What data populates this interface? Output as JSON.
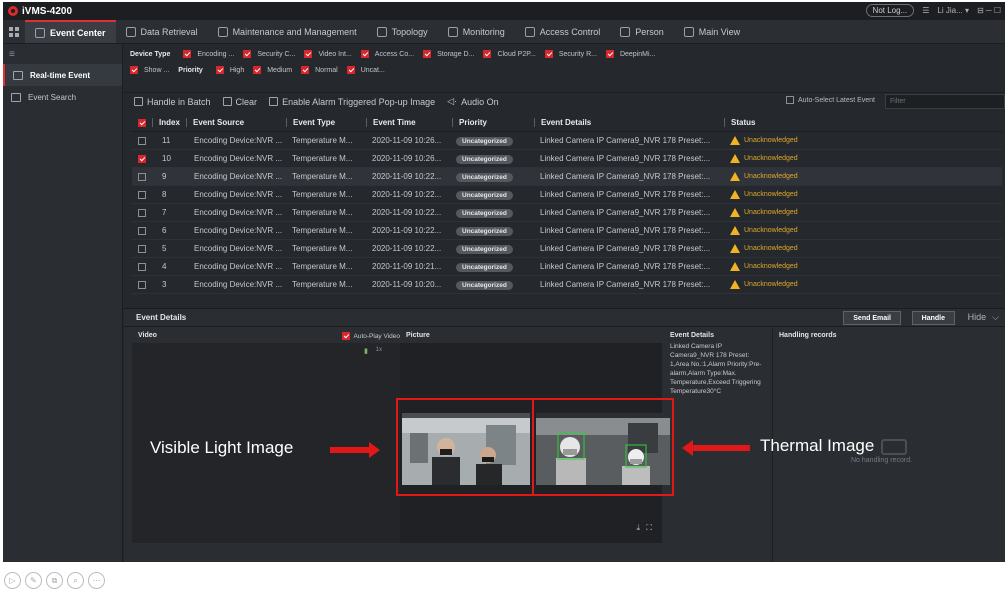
{
  "app": {
    "title": "iVMS-4200"
  },
  "titlebar": {
    "not_logged": "Not Log...",
    "user": "Li Jia... ▾",
    "controls": "⊟ ─ ☐"
  },
  "tabs": [
    {
      "label": "Event Center",
      "active": true
    },
    {
      "label": "Data Retrieval"
    },
    {
      "label": "Maintenance and Management"
    },
    {
      "label": "Topology"
    },
    {
      "label": "Monitoring"
    },
    {
      "label": "Access Control"
    },
    {
      "label": "Person"
    },
    {
      "label": "Main View"
    }
  ],
  "sidebar": {
    "menu_icon": "≡",
    "items": [
      {
        "label": "Real-time Event",
        "active": true
      },
      {
        "label": "Event Search"
      }
    ]
  },
  "filters": {
    "device_type_label": "Device Type",
    "device_types": [
      "Encoding ...",
      "Security C...",
      "Video Int...",
      "Access Co...",
      "Storage D...",
      "Cloud P2P...",
      "Security R...",
      "DeepinMi..."
    ],
    "show_label": "Show ...",
    "priority_label": "Priority",
    "priorities": [
      "High",
      "Medium",
      "Normal",
      "Uncat..."
    ]
  },
  "toolbar": {
    "handle_batch": "Handle in Batch",
    "clear": "Clear",
    "enable_popup": "Enable Alarm Triggered Pop-up Image",
    "audio_on": "Audio On",
    "auto_select": "Auto-Select Latest Event",
    "filter_placeholder": "Filter"
  },
  "table": {
    "headers": [
      "Index",
      "Event Source",
      "Event Type",
      "Event Time",
      "Priority",
      "Event Details",
      "Status"
    ],
    "rows": [
      {
        "index": "11",
        "source": "Encoding Device:NVR ...",
        "type": "Temperature M...",
        "time": "2020-11-09 10:26...",
        "priority": "Uncategorized",
        "details": "Linked Camera IP Camera9_NVR 178 Preset:...",
        "status": "Unacknowledged",
        "checked": false
      },
      {
        "index": "10",
        "source": "Encoding Device:NVR ...",
        "type": "Temperature M...",
        "time": "2020-11-09 10:26...",
        "priority": "Uncategorized",
        "details": "Linked Camera IP Camera9_NVR 178 Preset:...",
        "status": "Unacknowledged",
        "checked": true
      },
      {
        "index": "9",
        "source": "Encoding Device:NVR ...",
        "type": "Temperature M...",
        "time": "2020-11-09 10:22...",
        "priority": "Uncategorized",
        "details": "Linked Camera IP Camera9_NVR 178 Preset:...",
        "status": "Unacknowledged",
        "checked": false,
        "selected": true
      },
      {
        "index": "8",
        "source": "Encoding Device:NVR ...",
        "type": "Temperature M...",
        "time": "2020-11-09 10:22...",
        "priority": "Uncategorized",
        "details": "Linked Camera IP Camera9_NVR 178 Preset:...",
        "status": "Unacknowledged",
        "checked": false
      },
      {
        "index": "7",
        "source": "Encoding Device:NVR ...",
        "type": "Temperature M...",
        "time": "2020-11-09 10:22...",
        "priority": "Uncategorized",
        "details": "Linked Camera IP Camera9_NVR 178 Preset:...",
        "status": "Unacknowledged",
        "checked": false
      },
      {
        "index": "6",
        "source": "Encoding Device:NVR ...",
        "type": "Temperature M...",
        "time": "2020-11-09 10:22...",
        "priority": "Uncategorized",
        "details": "Linked Camera IP Camera9_NVR 178 Preset:...",
        "status": "Unacknowledged",
        "checked": false
      },
      {
        "index": "5",
        "source": "Encoding Device:NVR ...",
        "type": "Temperature M...",
        "time": "2020-11-09 10:22...",
        "priority": "Uncategorized",
        "details": "Linked Camera IP Camera9_NVR 178 Preset:...",
        "status": "Unacknowledged",
        "checked": false
      },
      {
        "index": "4",
        "source": "Encoding Device:NVR ...",
        "type": "Temperature M...",
        "time": "2020-11-09 10:21...",
        "priority": "Uncategorized",
        "details": "Linked Camera IP Camera9_NVR 178 Preset:...",
        "status": "Unacknowledged",
        "checked": false
      },
      {
        "index": "3",
        "source": "Encoding Device:NVR ...",
        "type": "Temperature M...",
        "time": "2020-11-09 10:20...",
        "priority": "Uncategorized",
        "details": "Linked Camera IP Camera9_NVR 178 Preset:...",
        "status": "Unacknowledged",
        "checked": false
      }
    ]
  },
  "details": {
    "title": "Event Details",
    "send_email": "Send Email",
    "handle": "Handle",
    "hide": "Hide",
    "video_label": "Video",
    "autoplay_label": "Auto-Play Video",
    "picture_label": "Picture",
    "event_details_label": "Event Details",
    "event_details_text": "Linked Camera IP Camera9_NVR 178 Preset: 1,Area No.:1,Alarm Priority:Pre-alarm,Alarm Type:Max. Temperature,Exceed Triggering Temperature30°C",
    "handling_label": "Handling records",
    "no_record": "No handling record."
  },
  "annotations": {
    "visible": "Visible Light Image",
    "thermal": "Thermal Image"
  },
  "colors": {
    "accent": "#d8262c",
    "warning": "#f0b323",
    "annotation": "#e01818"
  }
}
